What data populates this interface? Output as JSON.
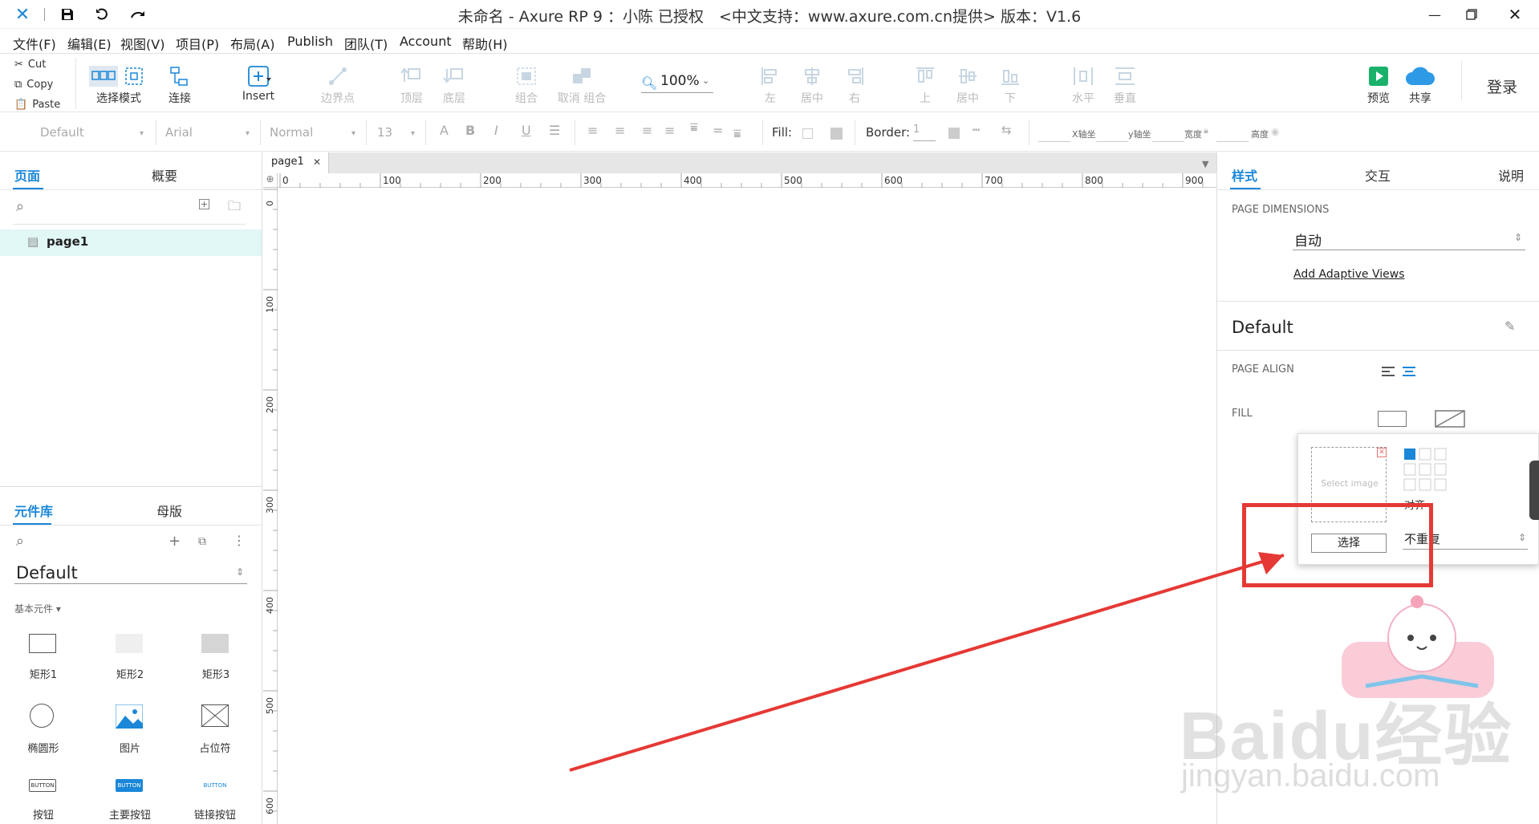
{
  "window": {
    "title": "未命名 - Axure RP 9 ：小陈 已授权　<中文支持：www.axure.com.cn提供> 版本：V1.6"
  },
  "menu": [
    "文件(F)",
    "编辑(E)",
    "视图(V)",
    "项目(P)",
    "布局(A)",
    "Publish",
    "团队(T)",
    "Account",
    "帮助(H)"
  ],
  "clipboard": {
    "cut": "Cut",
    "copy": "Copy",
    "paste": "Paste"
  },
  "toolbar": {
    "select_mode": "选择模式",
    "connect": "连接",
    "insert": "Insert",
    "boundary": "边界点",
    "top_layer": "顶层",
    "bottom_layer": "底层",
    "group": "组合",
    "ungroup": "取消 组合",
    "zoom": "100%",
    "align_left": "左",
    "align_center": "居中",
    "align_right": "右",
    "align_top": "上",
    "align_middle": "居中",
    "align_bottom": "下",
    "dist_h": "水平",
    "dist_v": "垂直",
    "preview": "预览",
    "share": "共享",
    "login": "登录"
  },
  "format": {
    "style": "Default",
    "font": "Arial",
    "weight": "Normal",
    "size": "13",
    "fill_label": "Fill:",
    "border_label": "Border:",
    "border_value": "1",
    "x_label": "X轴坐",
    "y_label": "y轴坐",
    "w_label": "宽度",
    "h_label": "高度"
  },
  "left_panel": {
    "tabs": [
      "页面",
      "概要"
    ],
    "pages": [
      "page1"
    ],
    "lib_tabs": [
      "元件库",
      "母版"
    ],
    "library_name": "Default",
    "section": "基本元件",
    "widgets": [
      "矩形1",
      "矩形2",
      "矩形3",
      "椭圆形",
      "图片",
      "占位符",
      "按钮",
      "主要按钮",
      "链接按钮"
    ],
    "btn_text": "BUTTON"
  },
  "canvas": {
    "tab": "page1",
    "ruler_h": [
      "0",
      "100",
      "200",
      "300",
      "400",
      "500",
      "600",
      "700",
      "800",
      "900"
    ],
    "ruler_v": [
      "0",
      "100",
      "200",
      "300",
      "400",
      "500",
      "600"
    ]
  },
  "right_panel": {
    "tabs": [
      "样式",
      "交互",
      "说明"
    ],
    "page_dimensions_label": "PAGE DIMENSIONS",
    "dimension_value": "自动",
    "adaptive_link": "Add Adaptive Views",
    "style_name": "Default",
    "page_align_label": "PAGE ALIGN",
    "fill_label": "FILL",
    "popup": {
      "select_image": "Select image",
      "choose_button": "选择",
      "align_label": "对齐",
      "repeat_value": "不重复"
    }
  },
  "watermark": {
    "brand": "Baidu经验",
    "url": "jingyan.baidu.com"
  },
  "colors": {
    "accent": "#1a87d8",
    "highlight": "#e53935",
    "selected_row": "#e0f7f6",
    "preview_green": "#1ab26b"
  }
}
